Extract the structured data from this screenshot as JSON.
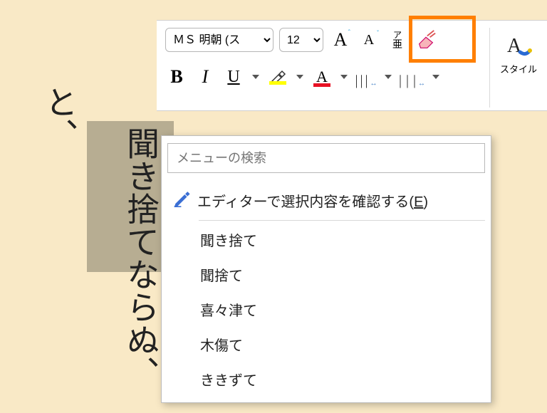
{
  "ribbon": {
    "font_name": "ＭＳ 明朝 (ス",
    "font_size": "12",
    "bold": "B",
    "italic": "I",
    "underline": "U",
    "phonetic_top": "ア",
    "phonetic_bot": "亜",
    "style_label": "スタイル"
  },
  "document": {
    "col1": "と、",
    "col2": "聞き捨てならぬ、"
  },
  "context_menu": {
    "search_placeholder": "メニューの検索",
    "editor_prefix": "エディターで選択内容を確認する(",
    "editor_hotkey": "E",
    "editor_suffix": ")",
    "suggestions": [
      "聞き捨て",
      "聞捨て",
      "喜々津て",
      "木傷て",
      "ききずて"
    ]
  }
}
